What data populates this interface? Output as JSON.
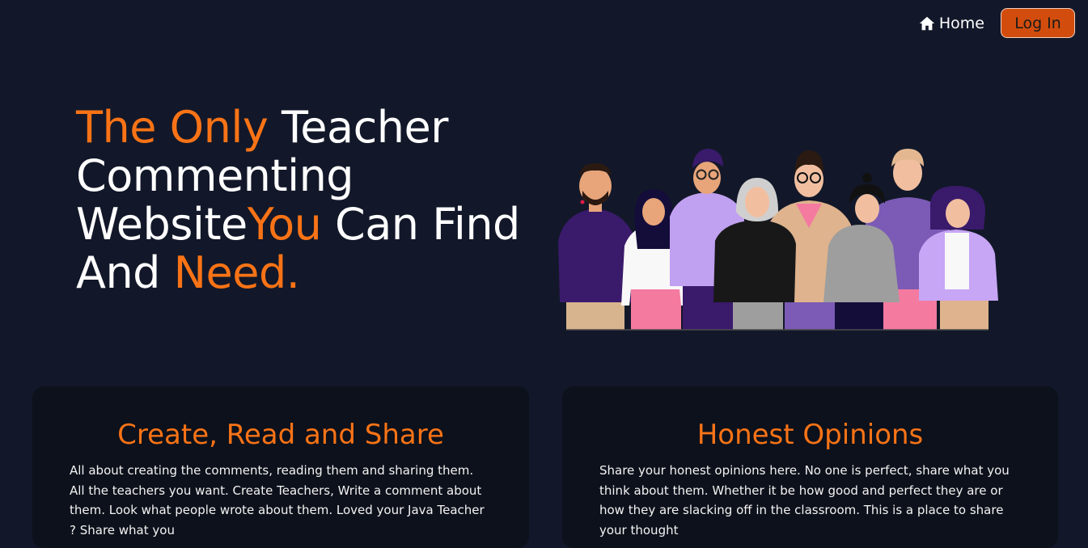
{
  "nav": {
    "home_label": "Home",
    "login_label": "Log In"
  },
  "hero": {
    "title_part1": "The Only",
    "title_part2": " Teacher Commenting Website",
    "title_part3": "You",
    "title_part4": " Can Find And ",
    "title_part5": "Need."
  },
  "cards": [
    {
      "title": "Create, Read and Share",
      "body": "All about creating the comments, reading them and sharing them. All the teachers you want. Create Teachers, Write a comment about them. Look what people wrote about them. Loved your Java Teacher ? Share what you"
    },
    {
      "title": "Honest Opinions",
      "body": "Share your honest opinions here. No one is perfect, share what you think about them. Whether it be how good and perfect they are or how they are slacking off in the classroom. This is a place to share your thought"
    }
  ],
  "colors": {
    "background": "#121829",
    "accent": "#f97316",
    "button": "#d24d0d",
    "card": "#0d111b"
  },
  "icons": {
    "home": "home-icon"
  }
}
